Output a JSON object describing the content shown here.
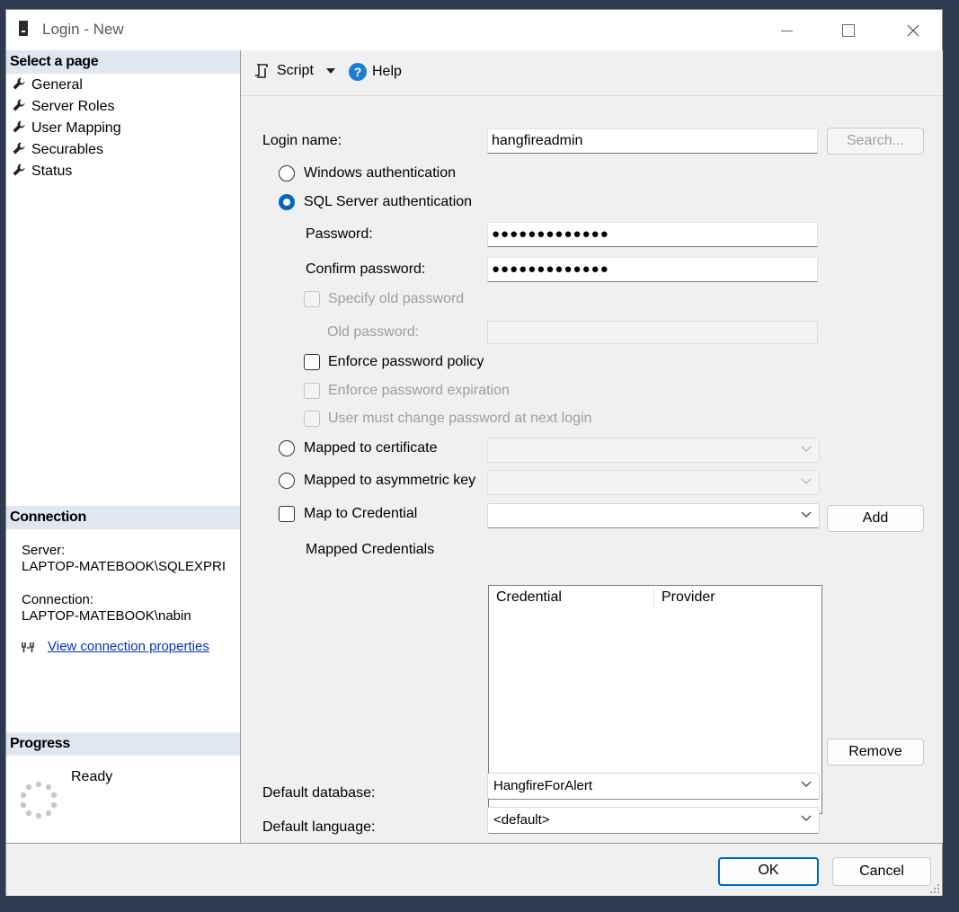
{
  "window": {
    "title": "Login - New",
    "controls": {
      "minimize": "minimize-icon",
      "maximize": "maximize-icon",
      "close": "close-icon"
    }
  },
  "sidebar": {
    "select_page_title": "Select a page",
    "pages": [
      {
        "label": "General",
        "icon": "wrench-icon",
        "active": true
      },
      {
        "label": "Server Roles",
        "icon": "wrench-icon"
      },
      {
        "label": "User Mapping",
        "icon": "wrench-icon"
      },
      {
        "label": "Securables",
        "icon": "wrench-icon"
      },
      {
        "label": "Status",
        "icon": "wrench-icon"
      }
    ],
    "connection": {
      "title": "Connection",
      "server_label": "Server:",
      "server_value": "LAPTOP-MATEBOOK\\SQLEXPRI",
      "connection_label": "Connection:",
      "connection_value": "LAPTOP-MATEBOOK\\nabin",
      "view_link": "View connection properties"
    },
    "progress": {
      "title": "Progress",
      "status": "Ready"
    }
  },
  "toolbar": {
    "script_label": "Script",
    "help_label": "Help"
  },
  "form": {
    "login_name_label": "Login name:",
    "login_name_value": "hangfireadmin",
    "search_button": "Search...",
    "windows_auth_label": "Windows authentication",
    "sql_auth_label": "SQL Server authentication",
    "password_label": "Password:",
    "password_value": "●●●●●●●●●●●●●",
    "confirm_password_label": "Confirm password:",
    "confirm_password_value": "●●●●●●●●●●●●●",
    "specify_old_password_label": "Specify old password",
    "old_password_label": "Old password:",
    "enforce_policy_label": "Enforce password policy",
    "enforce_expiration_label": "Enforce password expiration",
    "must_change_label": "User must change password at next login",
    "mapped_cert_label": "Mapped to certificate",
    "mapped_asym_label": "Mapped to asymmetric key",
    "map_credential_label": "Map to Credential",
    "add_button": "Add",
    "mapped_credentials_label": "Mapped Credentials",
    "credentials_columns": [
      "Credential",
      "Provider"
    ],
    "remove_button": "Remove",
    "default_database_label": "Default database:",
    "default_database_value": "HangfireForAlert",
    "default_language_label": "Default language:",
    "default_language_value": "<default>"
  },
  "footer": {
    "ok_button": "OK",
    "cancel_button": "Cancel"
  },
  "colors": {
    "accent": "#0067c0",
    "link": "#0033cc",
    "section_header_bg": "#dfe7f1",
    "desktop_bg": "#2d3a50"
  }
}
